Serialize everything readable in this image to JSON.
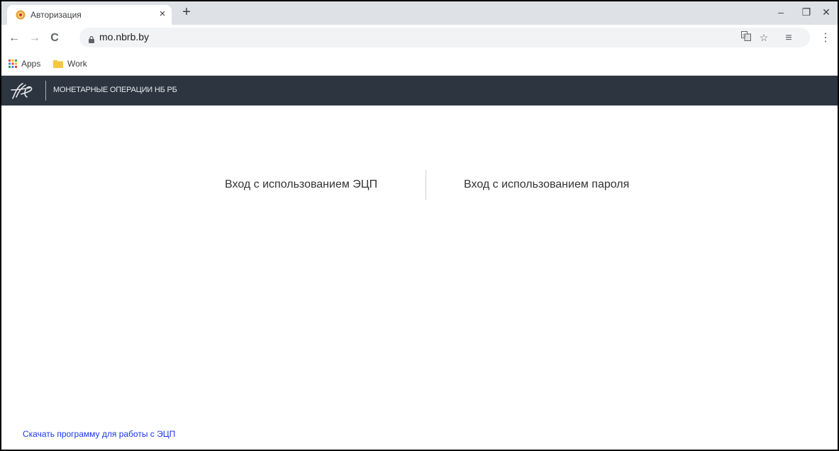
{
  "browser": {
    "tab_title": "Авторизация",
    "tab_close": "×",
    "new_tab": "+",
    "url": "mo.nbrb.by",
    "window_controls": {
      "minimize": "–",
      "restore": "❐",
      "close": "✕"
    }
  },
  "nav": {
    "back": "←",
    "forward": "→",
    "reload": "C"
  },
  "omnibox_icons": {
    "translate": "translate-icon",
    "bookmark_star": "☆",
    "reading_list": "≡"
  },
  "menu": "⋮",
  "bookmarks": [
    {
      "label": "Apps",
      "icon": "apps-grid-icon"
    },
    {
      "label": "Work",
      "icon": "folder-icon"
    }
  ],
  "site": {
    "title": "МОНЕТАРНЫЕ ОПЕРАЦИИ НБ РБ",
    "login_ecp": "Вход с использованием ЭЦП",
    "login_password": "Вход с использованием пароля",
    "download_link": "Скачать программу для работы с ЭЦП"
  },
  "colors": {
    "header_bg": "#2c3540",
    "link": "#1a37f0",
    "tabstrip": "#dee1e6",
    "omnibox": "#f1f3f4"
  }
}
